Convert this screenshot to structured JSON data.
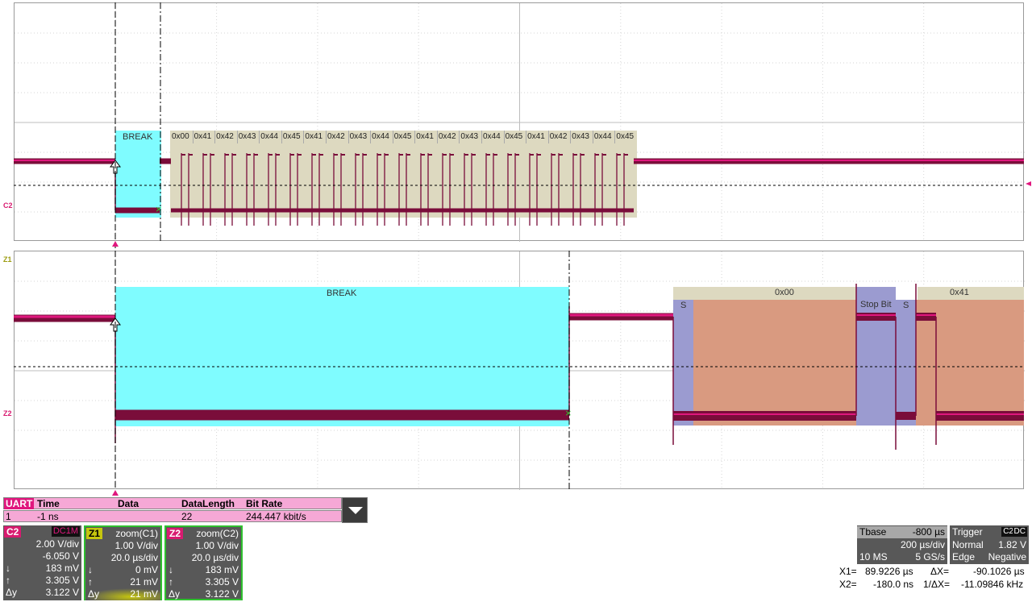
{
  "colors": {
    "break_fill": "#7ffcff",
    "bytes_fill": "#ddd9c0",
    "signal": "#7a0d3a",
    "signal_hi": "#e0177e",
    "start_fill": "#9b9bd0",
    "data_fill": "#d99a80",
    "uart_row": "#f6a8d6",
    "panel_bg": "#585858",
    "c2_tag": "#d81b70",
    "z1_tag": "#9c9c10",
    "z2_tag": "#d81b70"
  },
  "upper": {
    "channel_tag": "C2",
    "break_label": "BREAK",
    "bytes": [
      "0x00",
      "0x41",
      "0x42",
      "0x43",
      "0x44",
      "0x45",
      "0x41",
      "0x42",
      "0x43",
      "0x44",
      "0x45",
      "0x41",
      "0x42",
      "0x43",
      "0x44",
      "0x45",
      "0x41",
      "0x42",
      "0x43",
      "0x44",
      "0x45"
    ]
  },
  "lower": {
    "top_tag": "Z1",
    "channel_tag": "Z2",
    "break_label": "BREAK",
    "segments": {
      "byte1": "0x00",
      "byte2": "0x41",
      "start1": "S",
      "stop": "Stop Bit",
      "start2": "S"
    }
  },
  "uart_table": {
    "tag": "UART",
    "headers": [
      "Time",
      "Data",
      "DataLength",
      "Bit Rate"
    ],
    "row": {
      "index": "1",
      "time": "-1 ns",
      "data": "",
      "length": "22",
      "bitrate": "244.447 kbit/s"
    }
  },
  "channels": [
    {
      "tag": "C2",
      "extra": "DC1M",
      "title": "",
      "vdiv": "2.00 V/div",
      "line2": "-6.050 V",
      "line3_l": "↓",
      "line3": "183 mV",
      "line4_l": "↑",
      "line4": "3.305 V",
      "line5_l": "Δy",
      "line5": "3.122 V"
    },
    {
      "tag": "Z1",
      "extra": "",
      "title": "zoom(C1)",
      "vdiv": "1.00 V/div",
      "line2": "20.0 µs/div",
      "line3_l": "↓",
      "line3": "0 mV",
      "line4_l": "↑",
      "line4": "21 mV",
      "line5_l": "Δy",
      "line5": "21 mV"
    },
    {
      "tag": "Z2",
      "extra": "",
      "title": "zoom(C2)",
      "vdiv": "1.00 V/div",
      "line2": "20.0 µs/div",
      "line3_l": "↓",
      "line3": "183 mV",
      "line4_l": "↑",
      "line4": "3.305 V",
      "line5_l": "Δy",
      "line5": "3.122 V"
    }
  ],
  "timebase": {
    "label": "Tbase",
    "offset": "-800 µs",
    "per_div": "200 µs/div",
    "samples": "10 MS",
    "rate": "5 GS/s"
  },
  "trigger": {
    "label": "Trigger",
    "tag1": "C2",
    "tag2": "DC",
    "mode": "Normal",
    "level": "1.82 V",
    "type": "Edge",
    "slope": "Negative"
  },
  "measure": {
    "x1_label": "X1=",
    "x1": "89.9226 µs",
    "dx_label": "ΔX=",
    "dx": "-90.1026 µs",
    "x2_label": "X2=",
    "x2": "-180.0 ns",
    "inv_label": "1/ΔX=",
    "inv": "-11.09846 kHz"
  }
}
